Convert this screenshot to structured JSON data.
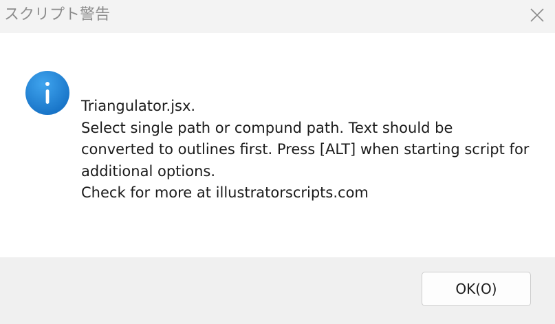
{
  "window": {
    "title": "スクリプト警告",
    "close_icon": "close-icon"
  },
  "dialog": {
    "icon": "info-icon",
    "icon_color": "#1e88d6",
    "message_lines": [
      "Triangulator.jsx.",
      "Select single path or compund path. Text should be",
      "converted to outlines first. Press [ALT] when starting script for",
      "additional options.",
      "Check for more at illustratorscripts.com"
    ]
  },
  "footer": {
    "ok_label": "OK(O)"
  }
}
